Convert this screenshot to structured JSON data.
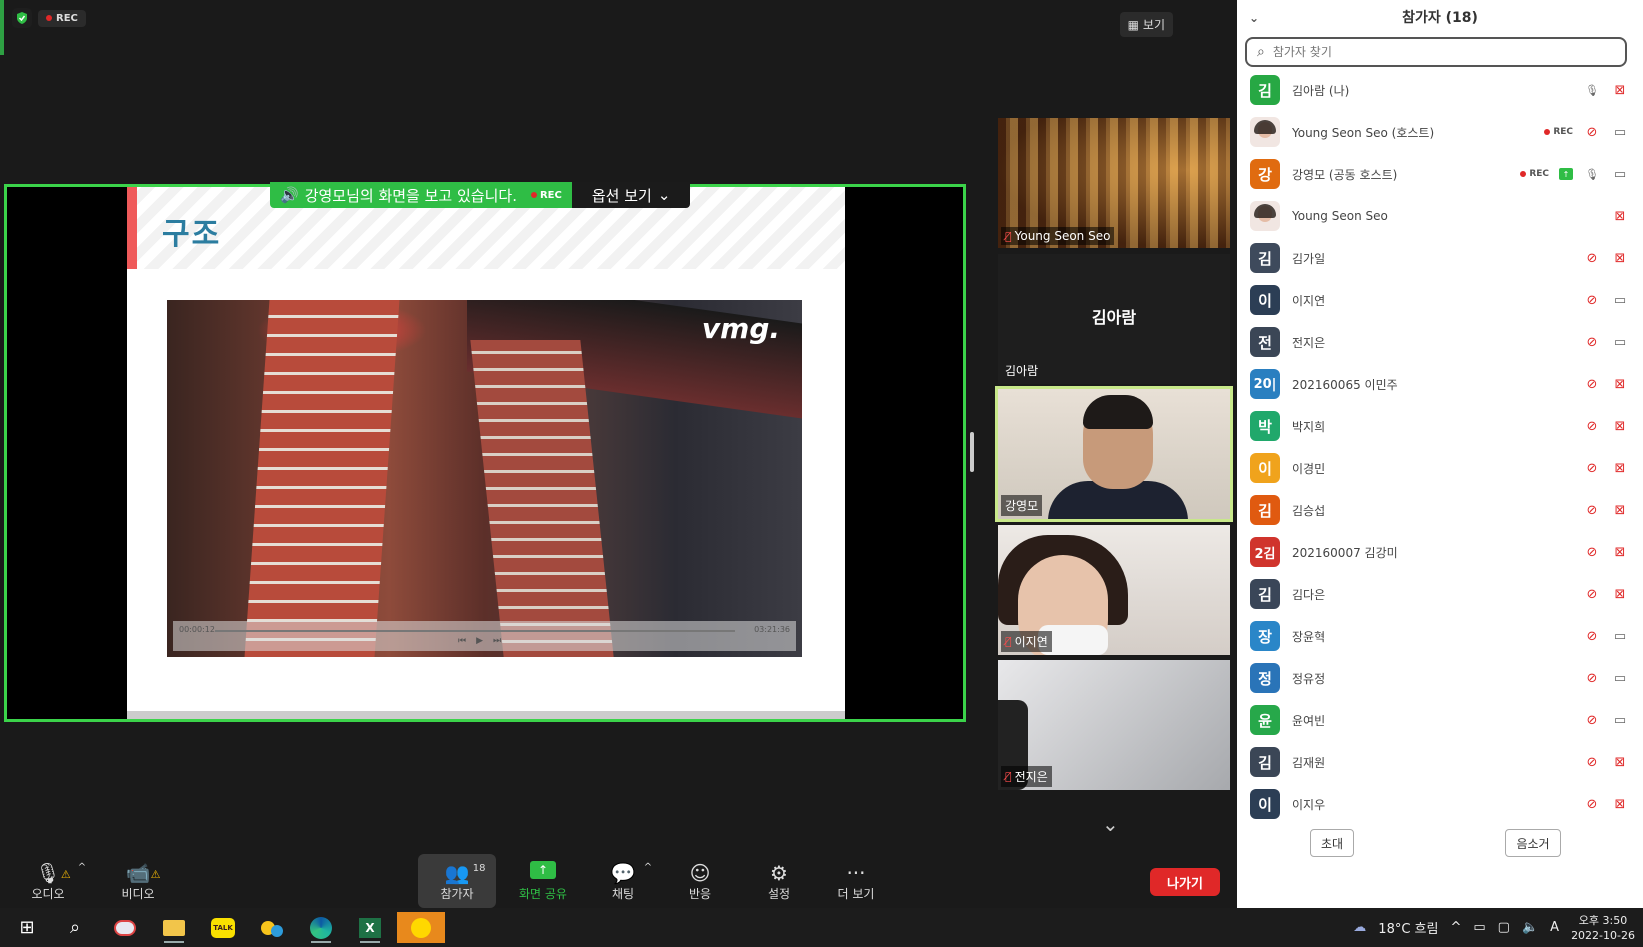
{
  "top": {
    "rec_label": "REC",
    "view_label": "보기"
  },
  "share": {
    "banner_text": "강영모님의 화면을 보고 있습니다.",
    "rec_label": "REC",
    "options_label": "옵션 보기",
    "slide_title": "구조",
    "video_brand": "vmg.",
    "video_time_start": "00:00:12",
    "video_time_end": "03:21:36"
  },
  "gallery": {
    "tiles": [
      {
        "name": "Young Seon Seo",
        "muted": true
      },
      {
        "name": "김아람",
        "center_name": "김아람",
        "muted": false
      },
      {
        "name": "강영모",
        "muted": false,
        "active_speaker": true
      },
      {
        "name": "이지연",
        "muted": true
      },
      {
        "name": "전지은",
        "muted": true
      }
    ]
  },
  "toolbar": {
    "audio": "오디오",
    "video": "비디오",
    "participants": "참가자",
    "participants_count": "18",
    "share": "화면 공유",
    "chat": "채팅",
    "reactions": "반응",
    "settings": "설정",
    "more": "더 보기",
    "leave": "나가기"
  },
  "panel": {
    "title": "참가자 (18)",
    "search_placeholder": "참가자 찾기",
    "invite": "초대",
    "mute_all": "음소거",
    "participants": [
      {
        "avatar": "김",
        "color": "#27a844",
        "name": "김아람 (나)",
        "mic": "on",
        "video": "off"
      },
      {
        "avatar": "photo",
        "color": "",
        "name": "Young Seon Seo (호스트)",
        "rec": "REC",
        "mic": "off",
        "video": "on"
      },
      {
        "avatar": "강",
        "color": "#e06b10",
        "name": "강영모 (공동 호스트)",
        "rec": "REC",
        "sharing": true,
        "mic": "on",
        "video": "on"
      },
      {
        "avatar": "photo",
        "color": "",
        "name": "Young Seon Seo",
        "mic": "none",
        "video": "off"
      },
      {
        "avatar": "김",
        "color": "#3e4a5c",
        "name": "김가일",
        "mic": "off",
        "video": "off"
      },
      {
        "avatar": "이",
        "color": "#2c3e55",
        "name": "이지연",
        "mic": "off",
        "video": "on"
      },
      {
        "avatar": "전",
        "color": "#3b4656",
        "name": "전지은",
        "mic": "off",
        "video": "on"
      },
      {
        "avatar": "20|",
        "color": "#2a7fc0",
        "name": "202160065 이민주",
        "mic": "off",
        "video": "off"
      },
      {
        "avatar": "박",
        "color": "#20a86b",
        "name": "박지희",
        "mic": "off",
        "video": "off"
      },
      {
        "avatar": "이",
        "color": "#f0a31c",
        "name": "이경민",
        "mic": "off",
        "video": "off"
      },
      {
        "avatar": "김",
        "color": "#e05a10",
        "name": "김승섭",
        "mic": "off",
        "video": "off"
      },
      {
        "avatar": "2김",
        "color": "#d0342c",
        "name": "202160007 김강미",
        "mic": "off",
        "video": "off"
      },
      {
        "avatar": "김",
        "color": "#3a4658",
        "name": "김다은",
        "mic": "off",
        "video": "off"
      },
      {
        "avatar": "장",
        "color": "#2a86c8",
        "name": "장윤혁",
        "mic": "off",
        "video": "on"
      },
      {
        "avatar": "정",
        "color": "#2a74b8",
        "name": "정유정",
        "mic": "off",
        "video": "on"
      },
      {
        "avatar": "윤",
        "color": "#27a84a",
        "name": "윤여빈",
        "mic": "off",
        "video": "on"
      },
      {
        "avatar": "김",
        "color": "#3b4656",
        "name": "김재원",
        "mic": "off",
        "video": "off"
      },
      {
        "avatar": "이",
        "color": "#2c3e55",
        "name": "이지우",
        "mic": "off",
        "video": "off"
      }
    ]
  },
  "taskbar": {
    "weather": "18°C 흐림",
    "ime": "A",
    "time": "오후 3:50",
    "date": "2022-10-26"
  }
}
